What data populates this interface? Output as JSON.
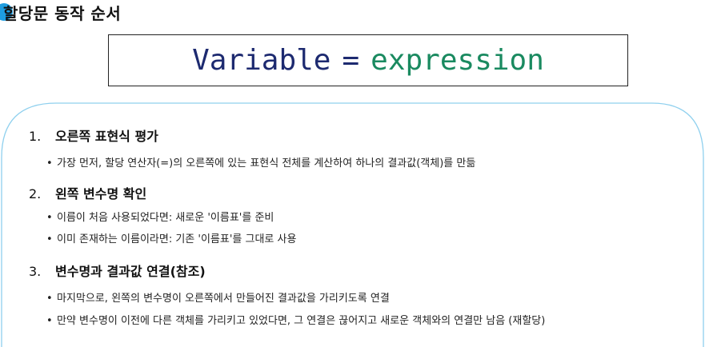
{
  "title": "할당문 동작 순서",
  "syntax": {
    "variable": "Variable",
    "operator": "=",
    "expression": "expression"
  },
  "bullet_glyph": "•",
  "steps": [
    {
      "number": "1.",
      "heading": "오른쪽 표현식 평가",
      "bullets": [
        "가장 먼저, 할당 연산자(=)의 오른쪽에 있는 표현식 전체를 계산하여 하나의 결과값(객체)를 만듦"
      ]
    },
    {
      "number": "2.",
      "heading": "왼쪽 변수명 확인",
      "bullets": [
        "이름이 처음 사용되었다면: 새로운 '이름표'를 준비",
        "이미 존재하는 이름이라면: 기존 '이름표'를 그대로 사용"
      ]
    },
    {
      "number": "3.",
      "heading": "변수명과 결과값 연결(참조)",
      "bullets": [
        "마지막으로, 왼쪽의 변수명이 오른쪽에서 만들어진 결과값을 가리키도록 연결",
        "만약 변수명이 이전에 다른 객체를 가리키고 있었다면, 그 연결은 끊어지고 새로운 객체와의 연결만 남음 (재할당)"
      ]
    }
  ],
  "colors": {
    "title_dot": "#1e9de0",
    "frame_line": "#8fd0ee",
    "code_variable": "#1d2a70",
    "code_expression": "#1a8a60"
  }
}
